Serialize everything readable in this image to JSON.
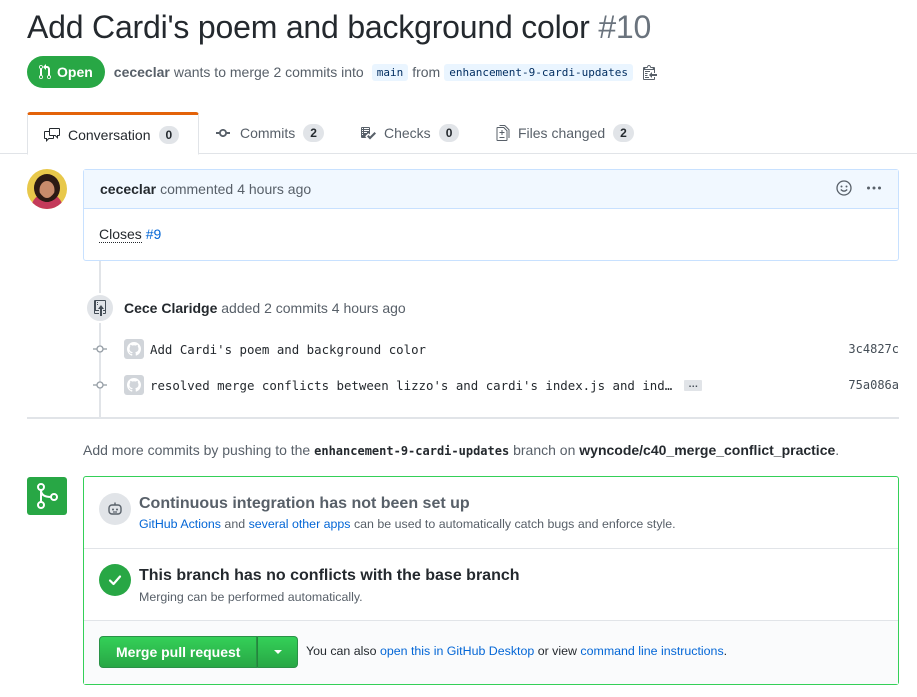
{
  "pr": {
    "title": "Add Cardi's poem and background color",
    "number": "#10",
    "state": "Open",
    "author": "cececlar",
    "merge_text": "wants to merge 2 commits into",
    "base_branch": "main",
    "from_text": "from",
    "head_branch": "enhancement-9-cardi-updates"
  },
  "tabs": [
    {
      "label": "Conversation",
      "count": "0"
    },
    {
      "label": "Commits",
      "count": "2"
    },
    {
      "label": "Checks",
      "count": "0"
    },
    {
      "label": "Files changed",
      "count": "2"
    }
  ],
  "comment": {
    "author": "cececlar",
    "action": "commented",
    "time": "4 hours ago",
    "body_prefix": "Closes",
    "body_link": "#9"
  },
  "commits": {
    "author": "Cece Claridge",
    "summary": "added 2 commits",
    "time": "4 hours ago",
    "items": [
      {
        "message": "Add Cardi's poem and background color",
        "sha": "3c4827c"
      },
      {
        "message": "resolved merge conflicts between lizzo's and cardi's index.js and ind…",
        "sha": "75a086a",
        "more": "…"
      }
    ]
  },
  "push_note": {
    "prefix": "Add more commits by pushing to the",
    "branch": "enhancement-9-cardi-updates",
    "middle": "branch on",
    "repo": "wyncode/c40_merge_conflict_practice",
    "suffix": "."
  },
  "ci": {
    "title": "Continuous integration has not been set up",
    "link1": "GitHub Actions",
    "and": "and",
    "link2": "several other apps",
    "rest": "can be used to automatically catch bugs and enforce style."
  },
  "conflicts": {
    "title": "This branch has no conflicts with the base branch",
    "subtitle": "Merging can be performed automatically."
  },
  "merge": {
    "button": "Merge pull request",
    "also_prefix": "You can also",
    "desktop_link": "open this in GitHub Desktop",
    "or_view": "or view",
    "cli_link": "command line instructions",
    "suffix": "."
  },
  "colors": {
    "open_green": "#28a745",
    "link_blue": "#0366d6",
    "tab_accent": "#e36209",
    "comment_border": "#c8e1ff"
  }
}
